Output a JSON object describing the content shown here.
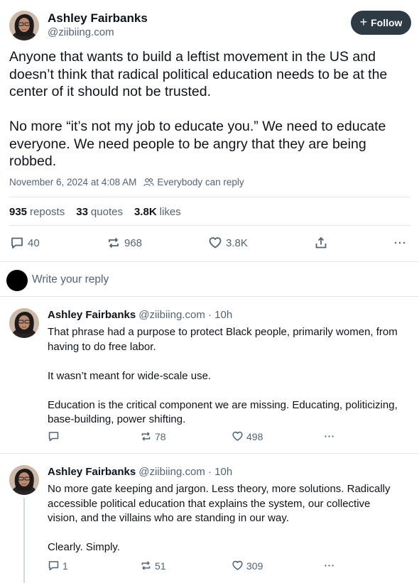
{
  "post": {
    "author_name": "Ashley Fairbanks",
    "author_handle": "@ziibiing.com",
    "follow_label": "Follow",
    "text": "Anyone that wants to build a leftist movement in the US and doesn’t think that radical political education needs to be at the center of it should not be trusted.\n\nNo more “it’s not my job to educate you.” We need to educate everyone. We need people to be angry that they are being robbed.",
    "timestamp": "November 6, 2024 at 4:08 AM",
    "reply_setting": "Everybody can reply",
    "stats": {
      "reposts_count": "935",
      "reposts_label": "reposts",
      "quotes_count": "33",
      "quotes_label": "quotes",
      "likes_count": "3.8K",
      "likes_label": "likes"
    },
    "actions": {
      "replies": "40",
      "reposts": "968",
      "likes": "3.8K"
    }
  },
  "reply_box": {
    "placeholder": "Write your reply"
  },
  "replies": [
    {
      "author_name": "Ashley Fairbanks",
      "handle_time": "@ziibiing.com · 10h",
      "text": "That phrase had a purpose to protect Black people, primarily women, from having to do free labor.\n\nIt wasn’t meant for wide-scale use.\n\nEducation is the critical component we are missing. Educating, politicizing, base-building, power shifting.",
      "replies": "",
      "reposts": "78",
      "likes": "498"
    },
    {
      "author_name": "Ashley Fairbanks",
      "handle_time": "@ziibiing.com · 10h",
      "text": "No more gate keeping and jargon. Less theory, more solutions. Radically accessible political education that explains the system, our collective vision, and the villains who are standing in our way.\n\nClearly. Simply.",
      "replies": "1",
      "reposts": "51",
      "likes": "309"
    }
  ],
  "icons": {
    "reply": "speech-bubble-icon",
    "repost": "repost-arrows-icon",
    "like": "heart-icon",
    "share": "share-icon",
    "more": "ellipsis-icon",
    "people": "people-icon"
  }
}
